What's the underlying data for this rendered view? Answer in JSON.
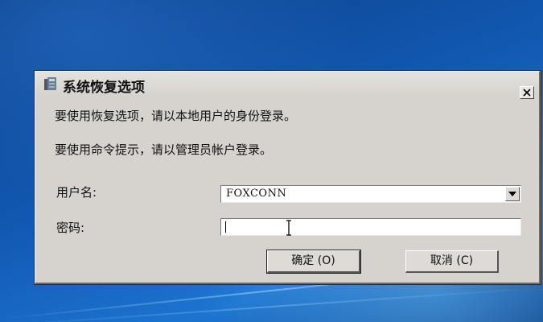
{
  "window": {
    "title": "系统恢复选项",
    "icon": "recovery-app-icon",
    "close_icon": "close-icon"
  },
  "messages": {
    "line1": "要使用恢复选项，请以本地用户的身份登录。",
    "line2": "要使用命令提示，请以管理员帐户登录。"
  },
  "form": {
    "username_label": "用户名:",
    "username_value": "FOXCONN",
    "password_label": "密码:",
    "password_value": ""
  },
  "buttons": {
    "ok_label": "确定 (O)",
    "cancel_label": "取消 (C)"
  },
  "colors": {
    "dialog_bg": "#d6d3ce",
    "desktop_bg": "#1259b3"
  }
}
